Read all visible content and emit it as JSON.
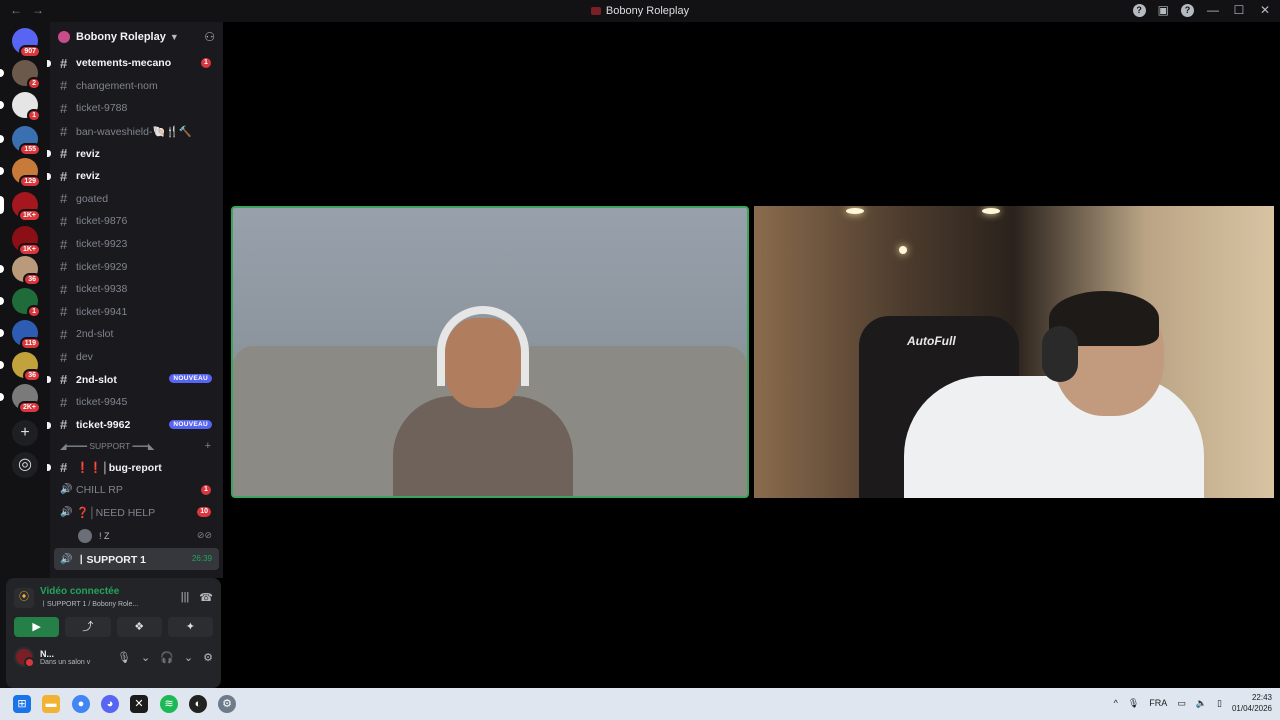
{
  "window": {
    "title": "Bobony Roleplay"
  },
  "servers": [
    {
      "badge": "907"
    },
    {
      "badge": "2"
    },
    {
      "badge": "1"
    },
    {
      "badge": "155"
    },
    {
      "badge": "129"
    },
    {
      "badge": "1K+"
    },
    {
      "badge": "1K+"
    },
    {
      "badge": "36"
    },
    {
      "badge": "1"
    },
    {
      "badge": "119"
    },
    {
      "badge": "36"
    },
    {
      "badge": "2K+"
    }
  ],
  "server_header": {
    "name": "Bobony Roleplay"
  },
  "channels": [
    {
      "name": "vetements-mecano",
      "unread": true,
      "count": "1"
    },
    {
      "name": "changement-nom"
    },
    {
      "name": "ticket-9788"
    },
    {
      "name": "ban-waveshield-🐚🍴🔨"
    },
    {
      "name": "reviz",
      "unread": true
    },
    {
      "name": "reviz",
      "unread": true
    },
    {
      "name": "goated"
    },
    {
      "name": "ticket-9876"
    },
    {
      "name": "ticket-9923"
    },
    {
      "name": "ticket-9929"
    },
    {
      "name": "ticket-9938"
    },
    {
      "name": "ticket-9941"
    },
    {
      "name": "2nd-slot"
    },
    {
      "name": "dev"
    },
    {
      "name": "2nd-slot",
      "unread": true,
      "new": "NOUVEAU"
    },
    {
      "name": "ticket-9945"
    },
    {
      "name": "ticket-9962",
      "unread": true,
      "new": "NOUVEAU"
    }
  ],
  "category": {
    "name": "◢━━━━ SUPPORT ━━━◣"
  },
  "support_channels": [
    {
      "name": "❗❗│bug-report",
      "type": "text",
      "unread": true
    },
    {
      "name": "CHILL RP",
      "type": "voice",
      "count": "1"
    },
    {
      "name": "❓│NEED HELP",
      "type": "voice",
      "count": "10"
    }
  ],
  "voice_user": {
    "name": "! Z"
  },
  "active_channel": {
    "name": "〡SUPPORT 1",
    "time": "26:39"
  },
  "voice_panel": {
    "status": "Vidéo connectée",
    "location": "〡SUPPORT 1 / Bobony Role..."
  },
  "user": {
    "name": "N...",
    "status": "Dans un salon v"
  },
  "tiles": [
    {
      "label": "participant-1"
    },
    {
      "label": "participant-2",
      "chair_text": "AutoFull"
    }
  ],
  "tray": {
    "lang": "FRA",
    "time": "22:43",
    "date": "01/04/2026"
  },
  "colors": {
    "accent_green": "#23a55a",
    "badge_red": "#da373c",
    "new_blue": "#5865f2"
  }
}
